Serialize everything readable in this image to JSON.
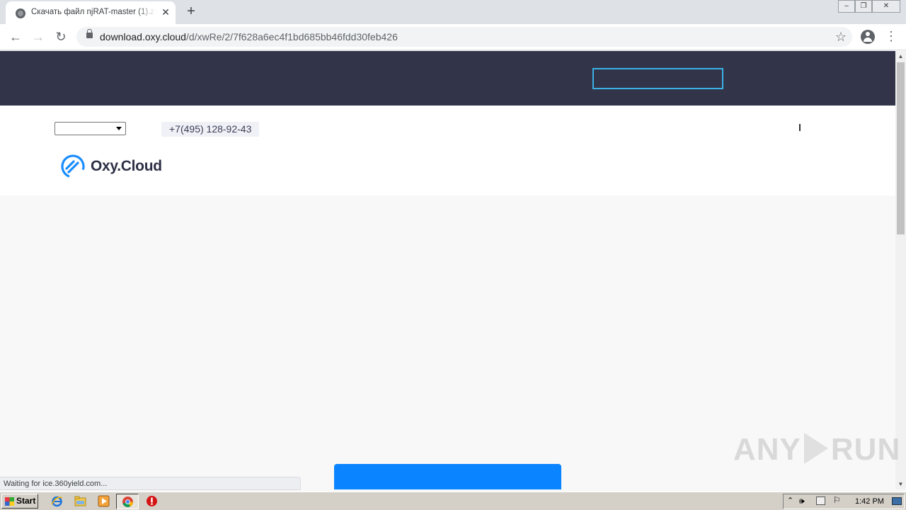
{
  "browser": {
    "tab_title": "Скачать файл njRAT-master (1).zip",
    "tab_close": "✕",
    "new_tab": "+",
    "url_host": "download.oxy.cloud",
    "url_path": "/d/xwRe/2/7f628a6ec4f1bd685bb46fdd30feb426",
    "back": "←",
    "forward": "→",
    "reload": "↻",
    "star": "☆",
    "menu": "⋮",
    "win_min": "–",
    "win_max": "❐",
    "win_close": "✕"
  },
  "page": {
    "phone": "+7(495) 128-92-43",
    "logo_text": "Oxy.Cloud",
    "language_select_value": ""
  },
  "status_bar": {
    "text": "Waiting for ice.360yield.com..."
  },
  "watermark": {
    "left": "ANY",
    "right": "RUN"
  },
  "taskbar": {
    "start_label": "Start",
    "clock": "1:42 PM"
  },
  "colors": {
    "header_dark": "#32344a",
    "accent_blue": "#0a84ff",
    "header_box_border": "#3bb2e5"
  },
  "icons": [
    "globe-icon",
    "back-icon",
    "forward-icon",
    "reload-icon",
    "lock-icon",
    "star-icon",
    "profile-icon",
    "menu-icon",
    "oxycloud-logo-icon",
    "ie-icon",
    "explorer-icon",
    "media-player-icon",
    "chrome-icon",
    "stop-icon"
  ]
}
